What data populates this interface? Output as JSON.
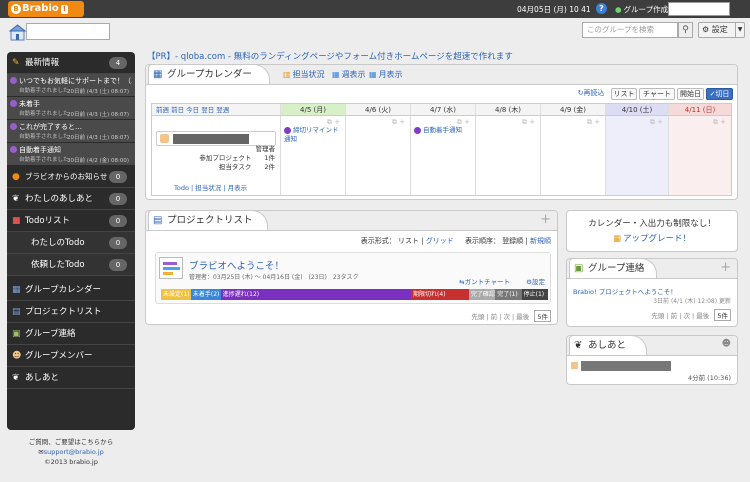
{
  "topbar": {
    "logo_text": "Brabio",
    "logo_badge": "!",
    "datetime": "04月05日 (月) 10 41",
    "help_icon": "?",
    "group_create": "グループ作成"
  },
  "groupbar": {
    "search_placeholder": "このグループを検索",
    "settings_label": "設定"
  },
  "sidebar": {
    "news_header": "最新情報",
    "news_count": "4",
    "news": [
      {
        "title": "いつでもお気軽にサポートまで！（…",
        "sub": "自動着手されました",
        "date": "20日前 (4/3 (土) 08:07)"
      },
      {
        "title": "未着手",
        "sub": "自動着手されました",
        "date": "20日前 (4/3 (土) 08:07)"
      },
      {
        "title": "これが完了すると…",
        "sub": "自動着手されました",
        "date": "20日前 (4/3 (土) 08:07)"
      },
      {
        "title": "自動着手通知",
        "sub": "自動着手されました",
        "date": "30日前 (4/2 (金) 08:00)"
      }
    ],
    "notice_label": "ブラビオからのお知らせ",
    "notice_count": "0",
    "myashiato_label": "わたしのあしあと",
    "myashiato_count": "0",
    "todo_label": "Todoリスト",
    "todo_count": "0",
    "mytodo_label": "わたしのTodo",
    "mytodo_count": "0",
    "reqtodo_label": "依頼したTodo",
    "reqtodo_count": "0",
    "menu": [
      {
        "label": "グループカレンダー",
        "icon": "calendar-icon"
      },
      {
        "label": "プロジェクトリスト",
        "icon": "project-icon"
      },
      {
        "label": "グループ連絡",
        "icon": "contact-icon"
      },
      {
        "label": "グループメンバー",
        "icon": "members-icon"
      },
      {
        "label": "あしあと",
        "icon": "footprint-icon"
      }
    ],
    "footer_line1": "ご質問、ご要望はこちらから",
    "footer_mail": "support@brabio.jp",
    "footer_copy": "©2013 brabio.jp"
  },
  "pr_text": "【PR】- qloba.com - 無料のランディングページやフォーム付きホームページを超速で作れます",
  "calendar": {
    "tab_title": "グループカレンダー",
    "link_tanto": "担当状況",
    "link_week": "週表示",
    "link_month": "月表示",
    "reload": "再読込",
    "btn_list": "リスト",
    "btn_chart": "チャート",
    "btn_start": "開始日",
    "btn_end": "切日",
    "nav": "前週 前日 今日 翌日 翌週",
    "days": [
      {
        "label": "4/5 (月)"
      },
      {
        "label": "4/6 (火)"
      },
      {
        "label": "4/7 (水)"
      },
      {
        "label": "4/8 (木)"
      },
      {
        "label": "4/9 (金)"
      },
      {
        "label": "4/10 (土)"
      },
      {
        "label": "4/11 (日)"
      }
    ],
    "user_role": "管理者",
    "user_projects": "参加プロジェクト　　1件",
    "user_tasks": "担当タスク　　2件",
    "user_links": "Todo | 担当状況 | 月表示",
    "event_mon": "締切リマインド通知",
    "event_wed": "自動着手通知"
  },
  "projects": {
    "tab_title": "プロジェクトリスト",
    "display_format": "表示形式：",
    "fmt_list": "リスト",
    "fmt_grid": "グリッド",
    "sort_label": "表示順序：",
    "sort_reg": "登録順",
    "sort_new": "新規順",
    "project_title": "ブラビオへようこそ！",
    "project_meta": "管理者：03月25日 (木) ～ 04月16日 (金)　(23日)　23タスク",
    "gantt": "ガントチャート",
    "setting": "設定",
    "segments": [
      {
        "label": "未設定(1)",
        "color": "#f0c040",
        "flex": 8
      },
      {
        "label": "未着手(2)",
        "color": "#3a86d8",
        "flex": 8
      },
      {
        "label": "進捗遅れ(12)",
        "color": "#7a2fc0",
        "flex": 54
      },
      {
        "label": "期限切れ(4)",
        "color": "#c83030",
        "flex": 16
      },
      {
        "label": "完了確認(1)",
        "color": "#aaaaaa",
        "flex": 7
      },
      {
        "label": "完了(1)",
        "color": "#777777",
        "flex": 7
      },
      {
        "label": "停止(1)",
        "color": "#444444",
        "flex": 7
      }
    ],
    "pager": "先頭 | 前 | 次 | 最後",
    "per_page": "5件"
  },
  "upgrade": {
    "text": "カレンダー・入出力も制限なし！",
    "link": "アップグレード！"
  },
  "group_contact": {
    "tab_title": "グループ連絡",
    "item": "Brabio! プロジェクトへようこそ！",
    "date": "3日前 (4/1 (木) 12:08) 更新",
    "pager": "先頭 | 前 | 次 | 最後",
    "per_page": "5件"
  },
  "ashiato": {
    "tab_title": "あしあと",
    "time": "4分前 (10:36)"
  }
}
